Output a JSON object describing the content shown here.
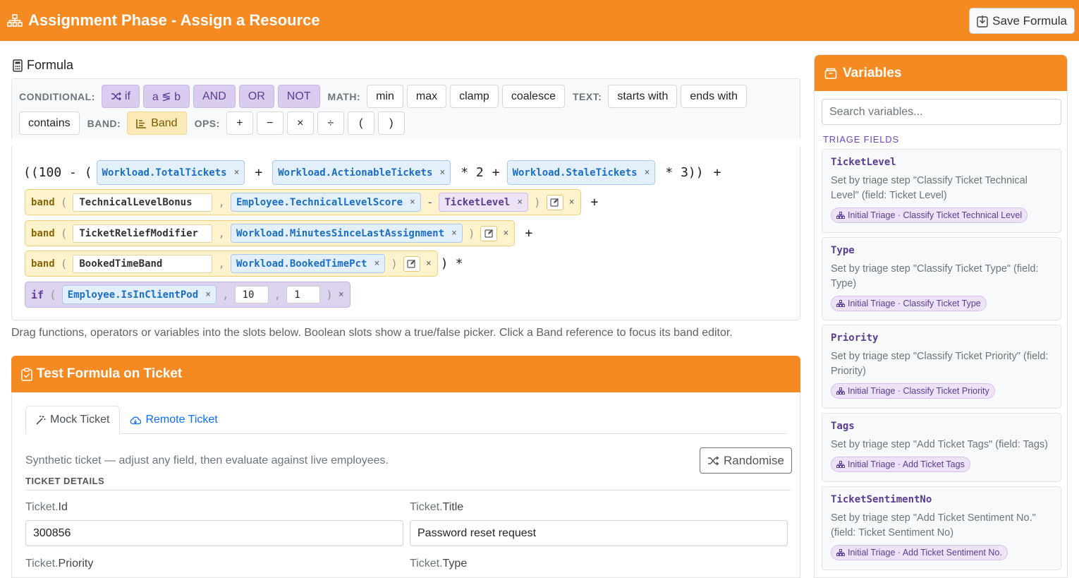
{
  "header": {
    "title": "Assignment Phase - Assign a Resource",
    "save_label": "Save Formula"
  },
  "formula": {
    "heading": "Formula",
    "palette": {
      "conditional_label": "CONDITIONAL:",
      "if_label": "if",
      "compare_label": "a ≶ b",
      "and_label": "AND",
      "or_label": "OR",
      "not_label": "NOT",
      "math_label": "MATH:",
      "min_label": "min",
      "max_label": "max",
      "clamp_label": "clamp",
      "coalesce_label": "coalesce",
      "text_label": "TEXT:",
      "starts_with_label": "starts with",
      "ends_with_label": "ends with",
      "contains_label": "contains",
      "band_section_label": "BAND:",
      "band_label": "Band",
      "ops_label": "OPS:",
      "op_plus": "+",
      "op_minus": "−",
      "op_times": "×",
      "op_divide": "÷",
      "op_lparen": "(",
      "op_rparen": ")"
    },
    "expr": {
      "open": "((100 - (",
      "v_total": "Workload.TotalTickets",
      "plus": "+",
      "v_actionable": "Workload.ActionableTickets",
      "times2": "* 2",
      "v_stale": "Workload.StaleTickets",
      "times3": "* 3))",
      "band_kw": "band",
      "lp": "(",
      "rp": ")",
      "comma": ",",
      "minus": "-",
      "x": "×",
      "star": "*",
      "band1_name": "TechnicalLevelBonus",
      "v_techscore": "Employee.TechnicalLevelScore",
      "v_ticketlevel": "TicketLevel",
      "band2_name": "TicketReliefModifier",
      "v_minutes": "Workload.MinutesSinceLastAssignment",
      "band3_name": "BookedTimeBand",
      "v_booked": "Workload.BookedTimePct",
      "if_kw": "if",
      "v_clientpod": "Employee.IsInClientPod",
      "if_true": "10",
      "if_false": "1"
    },
    "hint": "Drag functions, operators or variables into the slots below. Boolean slots show a true/false picker. Click a Band reference to focus its band editor."
  },
  "test": {
    "title": "Test Formula on Ticket",
    "tab_mock": "Mock Ticket",
    "tab_remote": "Remote Ticket",
    "synthetic_text": "Synthetic ticket — adjust any field, then evaluate against live employees.",
    "randomise_label": "Randomise",
    "details_label": "TICKET DETAILS",
    "entity": "Ticket.",
    "fields": [
      {
        "name": "Id",
        "value": "300856"
      },
      {
        "name": "Title",
        "value": "Password reset request"
      },
      {
        "name": "Priority",
        "value": ""
      },
      {
        "name": "Type",
        "value": ""
      }
    ]
  },
  "variables": {
    "title": "Variables",
    "search_placeholder": "Search variables...",
    "section_label": "TRIAGE FIELDS",
    "items": [
      {
        "name": "TicketLevel",
        "desc": "Set by triage step \"Classify Ticket Technical Level\" (field: Ticket Level)",
        "tag": "Initial Triage · Classify Ticket Technical Level"
      },
      {
        "name": "Type",
        "desc": "Set by triage step \"Classify Ticket Type\" (field: Type)",
        "tag": "Initial Triage · Classify Ticket Type"
      },
      {
        "name": "Priority",
        "desc": "Set by triage step \"Classify Ticket Priority\" (field: Priority)",
        "tag": "Initial Triage · Classify Ticket Priority"
      },
      {
        "name": "Tags",
        "desc": "Set by triage step \"Add Ticket Tags\" (field: Tags)",
        "tag": "Initial Triage · Add Ticket Tags"
      },
      {
        "name": "TicketSentimentNo",
        "desc": "Set by triage step \"Add Ticket Sentiment No.\" (field: Ticket Sentiment No)",
        "tag": "Initial Triage · Add Ticket Sentiment No."
      }
    ]
  },
  "colors": {
    "accent": "#f58a22",
    "var_blue": "#1a6fc4",
    "logic_purple": "#5a3c94",
    "band_yellow": "#fff3cd"
  },
  "icons": [
    "sitemap-icon",
    "save-icon",
    "calculator-icon",
    "shuffle-icon",
    "band-icon",
    "edit-icon",
    "clipboard-icon",
    "wand-icon",
    "cloud-icon",
    "box-icon"
  ]
}
